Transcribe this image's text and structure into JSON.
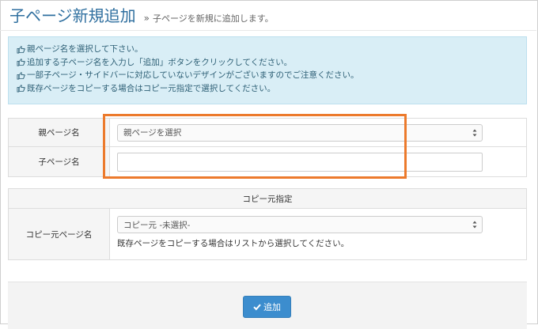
{
  "header": {
    "title": "子ページ新規追加",
    "separator": "»",
    "subtitle": "子ページを新規に追加します。"
  },
  "info": {
    "lines": [
      "親ページ名を選択して下さい。",
      "追加する子ページ名を入力し「追加」ボタンをクリックしてください。",
      "一部子ページ・サイドバーに対応していないデザインがございますのでご注意ください。",
      "既存ページをコピーする場合はコピー元指定で選択してください。"
    ],
    "icon": "hand-point-right-icon"
  },
  "form": {
    "parent_label": "親ページ名",
    "parent_select_value": "親ページを選択",
    "child_label": "子ページ名",
    "child_input_value": ""
  },
  "copy": {
    "heading": "コピー元指定",
    "label": "コピー元ページ名",
    "select_value": "コピー元 -未選択-",
    "help": "既存ページをコピーする場合はリストから選択してください。"
  },
  "actions": {
    "add_label": "追加",
    "add_icon": "check-icon"
  },
  "colors": {
    "title": "#2f6f9f",
    "info_bg": "#d9eef6",
    "info_text": "#2d5f75",
    "highlight": "#ec7a2c",
    "button": "#3c8dce"
  }
}
